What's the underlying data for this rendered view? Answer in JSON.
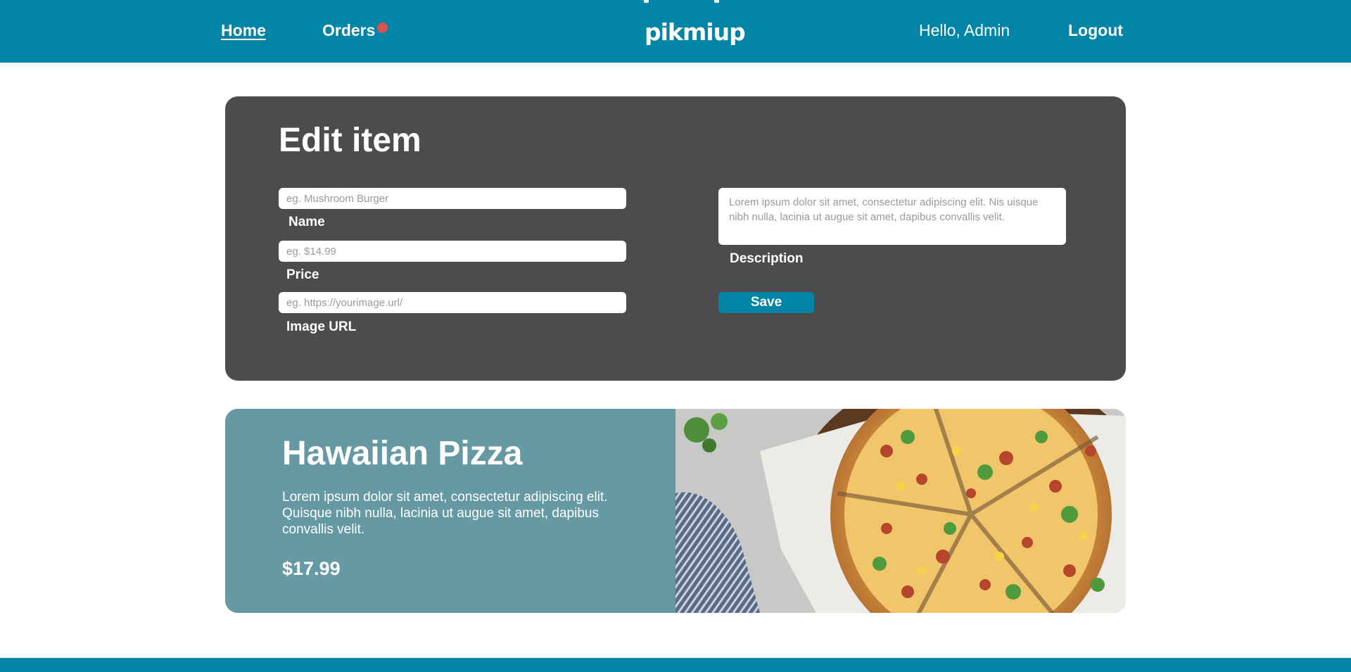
{
  "header": {
    "home_label": "Home",
    "orders_label": "Orders",
    "logo_text": "pikmiup",
    "greeting": "Hello, Admin",
    "logout_label": "Logout"
  },
  "edit_form": {
    "title": "Edit item",
    "name": {
      "label": "Name",
      "placeholder": "eg. Mushroom Burger",
      "value": ""
    },
    "price": {
      "label": "Price",
      "placeholder": "eg. $14.99",
      "value": ""
    },
    "image_url": {
      "label": "Image URL",
      "placeholder": "eg. https://yourimage.url/",
      "value": ""
    },
    "description": {
      "label": "Description",
      "placeholder": "Lorem ipsum dolor sit amet, consectetur adipiscing elit. Nis uisque nibh nulla, lacinia ut augue sit amet, dapibus convallis velit.",
      "value": ""
    },
    "save_label": "Save"
  },
  "preview": {
    "title": "Hawaiian Pizza",
    "description": "Lorem ipsum dolor sit amet, consectetur adipiscing elit. Quisque nibh nulla, lacinia ut augue sit amet, dapibus convallis velit.",
    "price": "$17.99"
  },
  "colors": {
    "brand": "#0185a6",
    "panel": "#4c4c4c",
    "card": "#6599a4",
    "notification": "#d9534f"
  },
  "icons": {
    "orders_badge": "notification-dot-icon",
    "preview_image": "pizza-photo"
  }
}
